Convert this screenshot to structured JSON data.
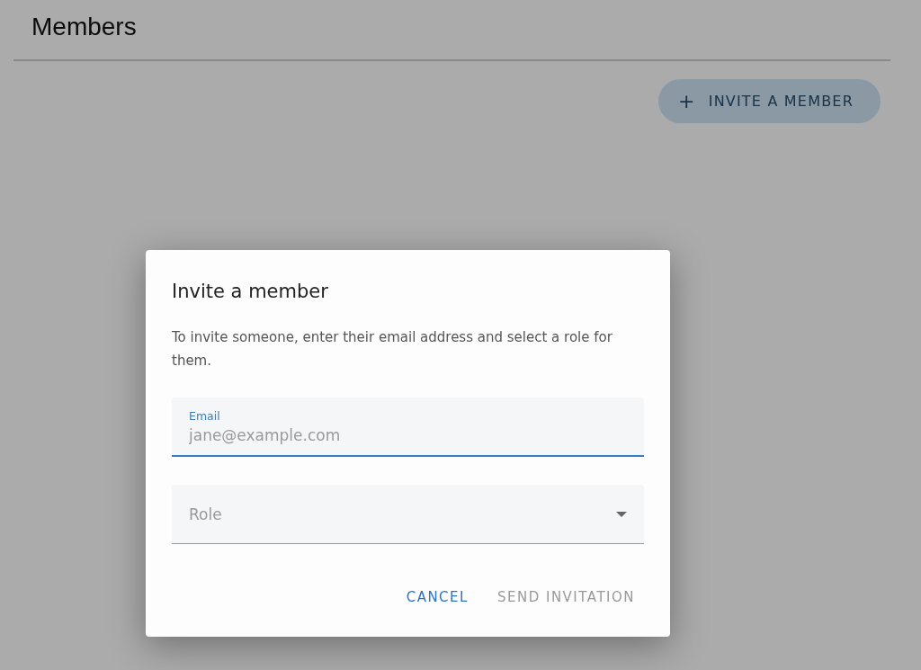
{
  "page": {
    "title": "Members"
  },
  "invite_button": {
    "icon": "+",
    "label": "INVITE A MEMBER"
  },
  "dialog": {
    "title": "Invite a member",
    "description": "To invite someone, enter their email address and select a role for them.",
    "email_field": {
      "label": "Email",
      "placeholder": "jane@example.com",
      "focused": true
    },
    "role_field": {
      "label": "Role",
      "focused": false
    },
    "buttons": [
      {
        "label": "CANCEL",
        "disabled": false
      },
      {
        "label": "SEND INVITATION",
        "disabled": true
      }
    ]
  }
}
